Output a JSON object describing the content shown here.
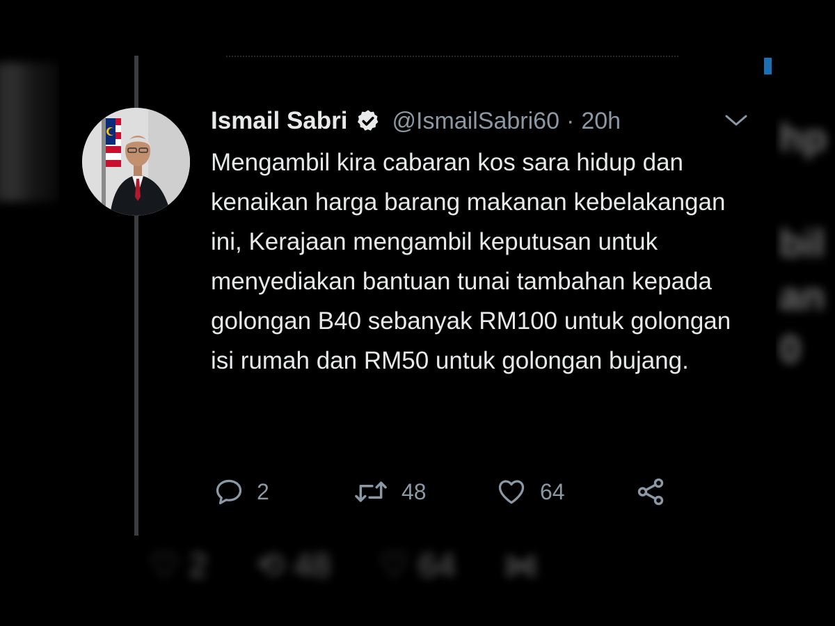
{
  "tweet": {
    "author": {
      "name": "Ismail Sabri",
      "handle": "@IsmailSabri60",
      "verified": true
    },
    "separator": "·",
    "time": "20h",
    "text": "Mengambil kira cabaran kos sara hidup dan kenaikan harga barang makanan kebelakangan ini, Kerajaan mengambil keputusan untuk menyediakan bantuan tunai tambahan kepada golongan B40 sebanyak RM100 untuk golongan isi rumah dan RM50 untuk golongan bujang.",
    "stats": {
      "replies": "2",
      "retweets": "48",
      "likes": "64"
    },
    "icons": {
      "reply": "reply-icon",
      "retweet": "retweet-icon",
      "like": "heart-icon",
      "share": "share-icon",
      "menu": "chevron-down-icon",
      "verified": "verified-badge-icon"
    }
  },
  "colors": {
    "background": "#000000",
    "text_primary": "#e7e9ea",
    "text_secondary": "#8b98a5",
    "thread_line": "#3a3d40",
    "accent": "#1d6fb3"
  }
}
